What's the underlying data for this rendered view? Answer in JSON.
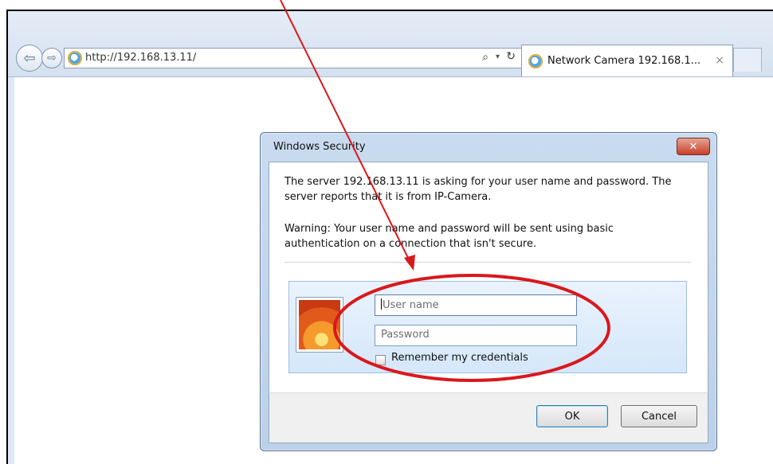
{
  "browser": {
    "address_url": "http://192.168.13.11/",
    "tab_title": "Network Camera 192.168.1...",
    "tab_close": "×",
    "back_icon": "⇦",
    "forward_icon": "⇨",
    "search_icon": "⌕",
    "dropdown_icon": "▾",
    "refresh_icon": "↻"
  },
  "dialog": {
    "title": "Windows Security",
    "close_glyph": "✕",
    "message1": "The server 192.168.13.11 is asking for your user name and password. The server reports that it is from IP-Camera.",
    "message2": "Warning: Your user name and password will be sent using basic authentication on a connection that isn't secure.",
    "username_placeholder": "User name",
    "password_placeholder": "Password",
    "remember_label": "Remember my credentials",
    "ok_label": "OK",
    "cancel_label": "Cancel"
  },
  "annotation": {
    "color": "#d9181c"
  }
}
